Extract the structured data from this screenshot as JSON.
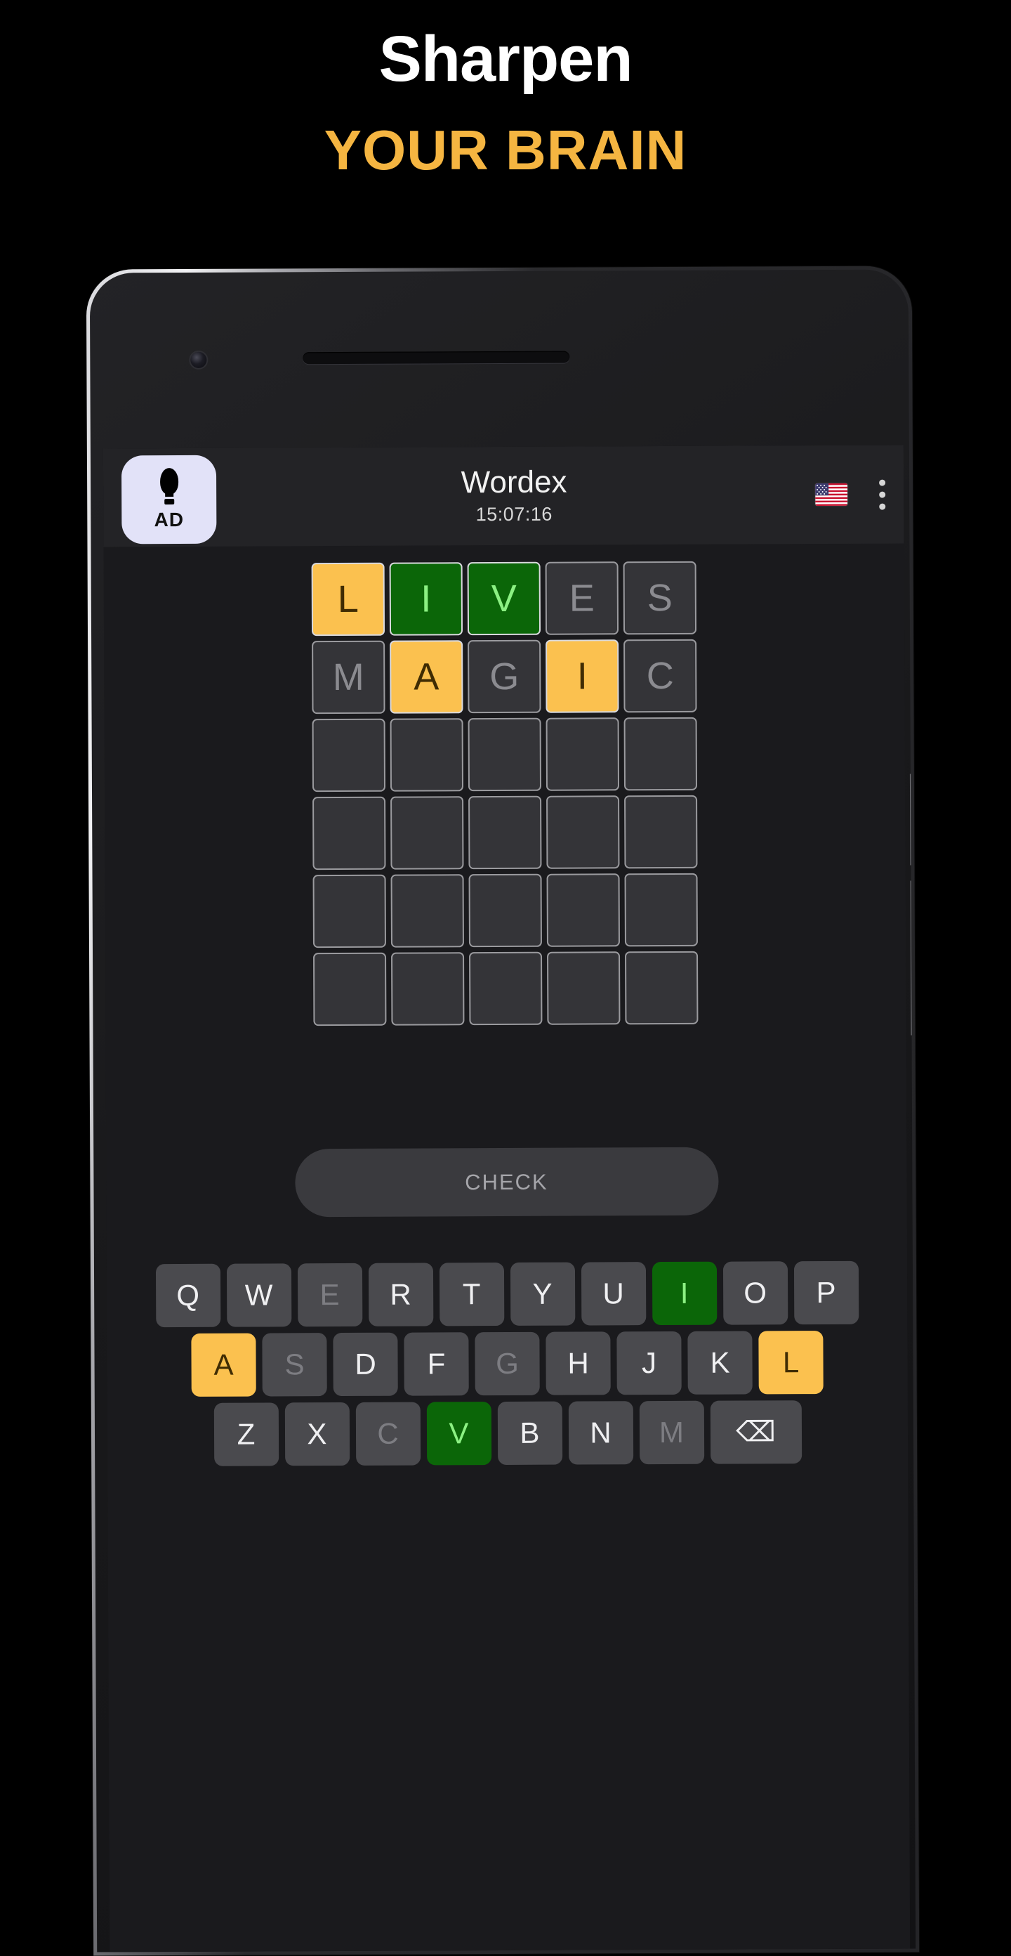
{
  "promo": {
    "line1": "Sharpen",
    "line2": "YOUR BRAIN",
    "line1_color": "#ffffff",
    "line2_color": "#f5b541"
  },
  "app": {
    "title": "Wordex",
    "timer": "15:07:16",
    "ad_badge": {
      "label": "AD",
      "icon": "lightbulb-icon"
    },
    "language_flag": "us-flag-icon",
    "overflow_menu": "kebab-menu-icon"
  },
  "colors": {
    "present": "#fbc14f",
    "correct": "#0b6608",
    "absent": "#343438",
    "screen_bg": "#1a1a1d",
    "appbar_bg": "#232326",
    "key_bg": "#4a4a4e"
  },
  "grid": {
    "rows": 6,
    "cols": 5,
    "cells": [
      [
        {
          "letter": "L",
          "state": "present"
        },
        {
          "letter": "I",
          "state": "correct"
        },
        {
          "letter": "V",
          "state": "correct"
        },
        {
          "letter": "E",
          "state": "absent"
        },
        {
          "letter": "S",
          "state": "absent"
        }
      ],
      [
        {
          "letter": "M",
          "state": "absent"
        },
        {
          "letter": "A",
          "state": "present"
        },
        {
          "letter": "G",
          "state": "absent"
        },
        {
          "letter": "I",
          "state": "present"
        },
        {
          "letter": "C",
          "state": "absent"
        }
      ],
      [
        {
          "letter": "",
          "state": "empty"
        },
        {
          "letter": "",
          "state": "empty"
        },
        {
          "letter": "",
          "state": "empty"
        },
        {
          "letter": "",
          "state": "empty"
        },
        {
          "letter": "",
          "state": "empty"
        }
      ],
      [
        {
          "letter": "",
          "state": "empty"
        },
        {
          "letter": "",
          "state": "empty"
        },
        {
          "letter": "",
          "state": "empty"
        },
        {
          "letter": "",
          "state": "empty"
        },
        {
          "letter": "",
          "state": "empty"
        }
      ],
      [
        {
          "letter": "",
          "state": "empty"
        },
        {
          "letter": "",
          "state": "empty"
        },
        {
          "letter": "",
          "state": "empty"
        },
        {
          "letter": "",
          "state": "empty"
        },
        {
          "letter": "",
          "state": "empty"
        }
      ],
      [
        {
          "letter": "",
          "state": "empty"
        },
        {
          "letter": "",
          "state": "empty"
        },
        {
          "letter": "",
          "state": "empty"
        },
        {
          "letter": "",
          "state": "empty"
        },
        {
          "letter": "",
          "state": "empty"
        }
      ]
    ]
  },
  "check_button": {
    "label": "CHECK"
  },
  "keyboard": {
    "rows": [
      [
        {
          "key": "Q",
          "state": "idle"
        },
        {
          "key": "W",
          "state": "idle"
        },
        {
          "key": "E",
          "state": "dim"
        },
        {
          "key": "R",
          "state": "idle"
        },
        {
          "key": "T",
          "state": "idle"
        },
        {
          "key": "Y",
          "state": "idle"
        },
        {
          "key": "U",
          "state": "idle"
        },
        {
          "key": "I",
          "state": "correct"
        },
        {
          "key": "O",
          "state": "idle"
        },
        {
          "key": "P",
          "state": "idle"
        }
      ],
      [
        {
          "key": "A",
          "state": "present"
        },
        {
          "key": "S",
          "state": "dim"
        },
        {
          "key": "D",
          "state": "idle"
        },
        {
          "key": "F",
          "state": "idle"
        },
        {
          "key": "G",
          "state": "dim"
        },
        {
          "key": "H",
          "state": "idle"
        },
        {
          "key": "J",
          "state": "idle"
        },
        {
          "key": "K",
          "state": "idle"
        },
        {
          "key": "L",
          "state": "present"
        }
      ],
      [
        {
          "key": "Z",
          "state": "idle"
        },
        {
          "key": "X",
          "state": "idle"
        },
        {
          "key": "C",
          "state": "dim"
        },
        {
          "key": "V",
          "state": "correct"
        },
        {
          "key": "B",
          "state": "idle"
        },
        {
          "key": "N",
          "state": "idle"
        },
        {
          "key": "M",
          "state": "dim"
        },
        {
          "key": "⌫",
          "state": "idle",
          "name": "backspace-key"
        }
      ]
    ]
  }
}
